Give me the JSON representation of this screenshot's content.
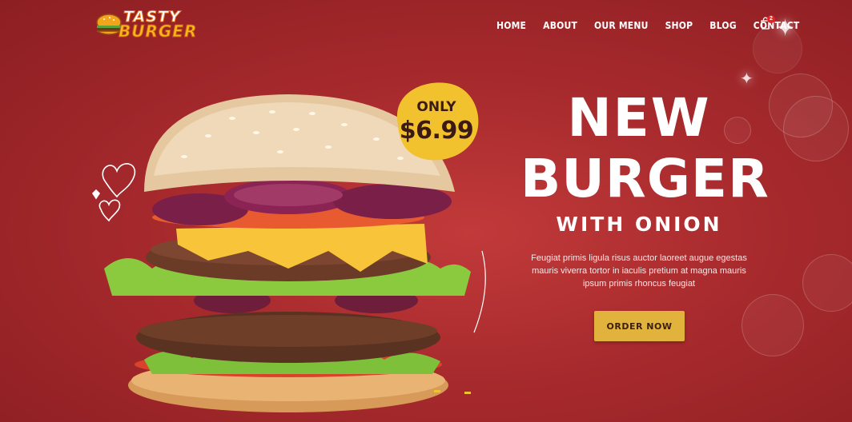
{
  "brand": {
    "name_line1": "TASTY",
    "name_line2": "BURGER",
    "icon": "burger-logo-icon"
  },
  "nav": {
    "items": [
      {
        "label": "HOME"
      },
      {
        "label": "ABOUT"
      },
      {
        "label": "OUR MENU"
      },
      {
        "label": "SHOP"
      },
      {
        "label": "BLOG"
      },
      {
        "label": "CONTACT"
      }
    ],
    "cart_icon": "shopping-bag-icon",
    "cart_count": "2"
  },
  "hero": {
    "price_label": "ONLY",
    "price": "$6.99",
    "title_line1": "NEW",
    "title_line2": "BURGER",
    "subtitle": "WITH ONION",
    "description": "Feugiat primis ligula risus auctor laoreet augue egestas mauris viverra tortor in iaculis pretium at magna mauris ipsum primis rhoncus feugiat",
    "cta_label": "ORDER NOW",
    "image_icon": "burger-image",
    "decor_icon": "hearts-doodle-icon"
  },
  "colors": {
    "background": "#a72a2d",
    "accent": "#e2b33c",
    "badge": "#f2c12e",
    "text": "#ffffff"
  }
}
